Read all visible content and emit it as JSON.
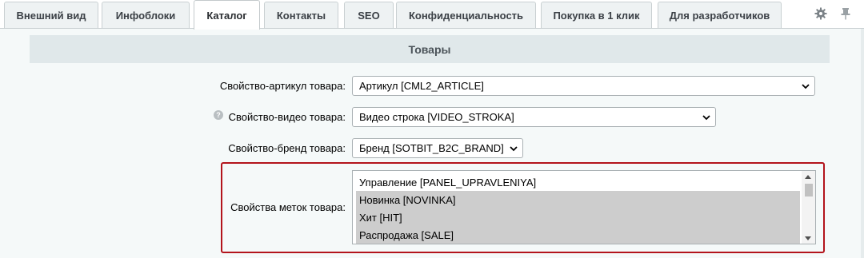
{
  "tabs": [
    {
      "label": "Внешний вид",
      "active": false
    },
    {
      "label": "Инфоблоки",
      "active": false
    },
    {
      "label": "Каталог",
      "active": true
    },
    {
      "label": "Контакты",
      "active": false
    },
    {
      "label": "SEO",
      "active": false
    },
    {
      "label": "Конфиденциальность",
      "active": false
    },
    {
      "label": "Покупка в 1 клик",
      "active": false
    },
    {
      "label": "Для разработчиков",
      "active": false
    }
  ],
  "toolbar_icons": [
    "gear-icon",
    "pin-icon"
  ],
  "section": {
    "title": "Товары"
  },
  "fields": {
    "article": {
      "label": "Свойство-артикул товара:",
      "value": "Артикул [CML2_ARTICLE]"
    },
    "video": {
      "label": "Свойство-видео товара:",
      "value": "Видео строка [VIDEO_STROKA]",
      "help_icon": "?"
    },
    "brand": {
      "label": "Свойство-бренд товара:",
      "value": "Бренд [SOTBIT_B2C_BRAND]"
    },
    "labels": {
      "label": "Свойства меток товара:",
      "options": [
        {
          "text": "Управление [PANEL_UPRAVLENIYA]",
          "selected": false
        },
        {
          "text": "Новинка [NOVINKA]",
          "selected": true
        },
        {
          "text": "Хит [HIT]",
          "selected": true
        },
        {
          "text": "Распродажа [SALE]",
          "selected": true
        }
      ]
    }
  },
  "colors": {
    "highlight_border": "#b3141c",
    "selected_option": "#cdcdcd",
    "section_header_bg": "#e0e8ea"
  }
}
